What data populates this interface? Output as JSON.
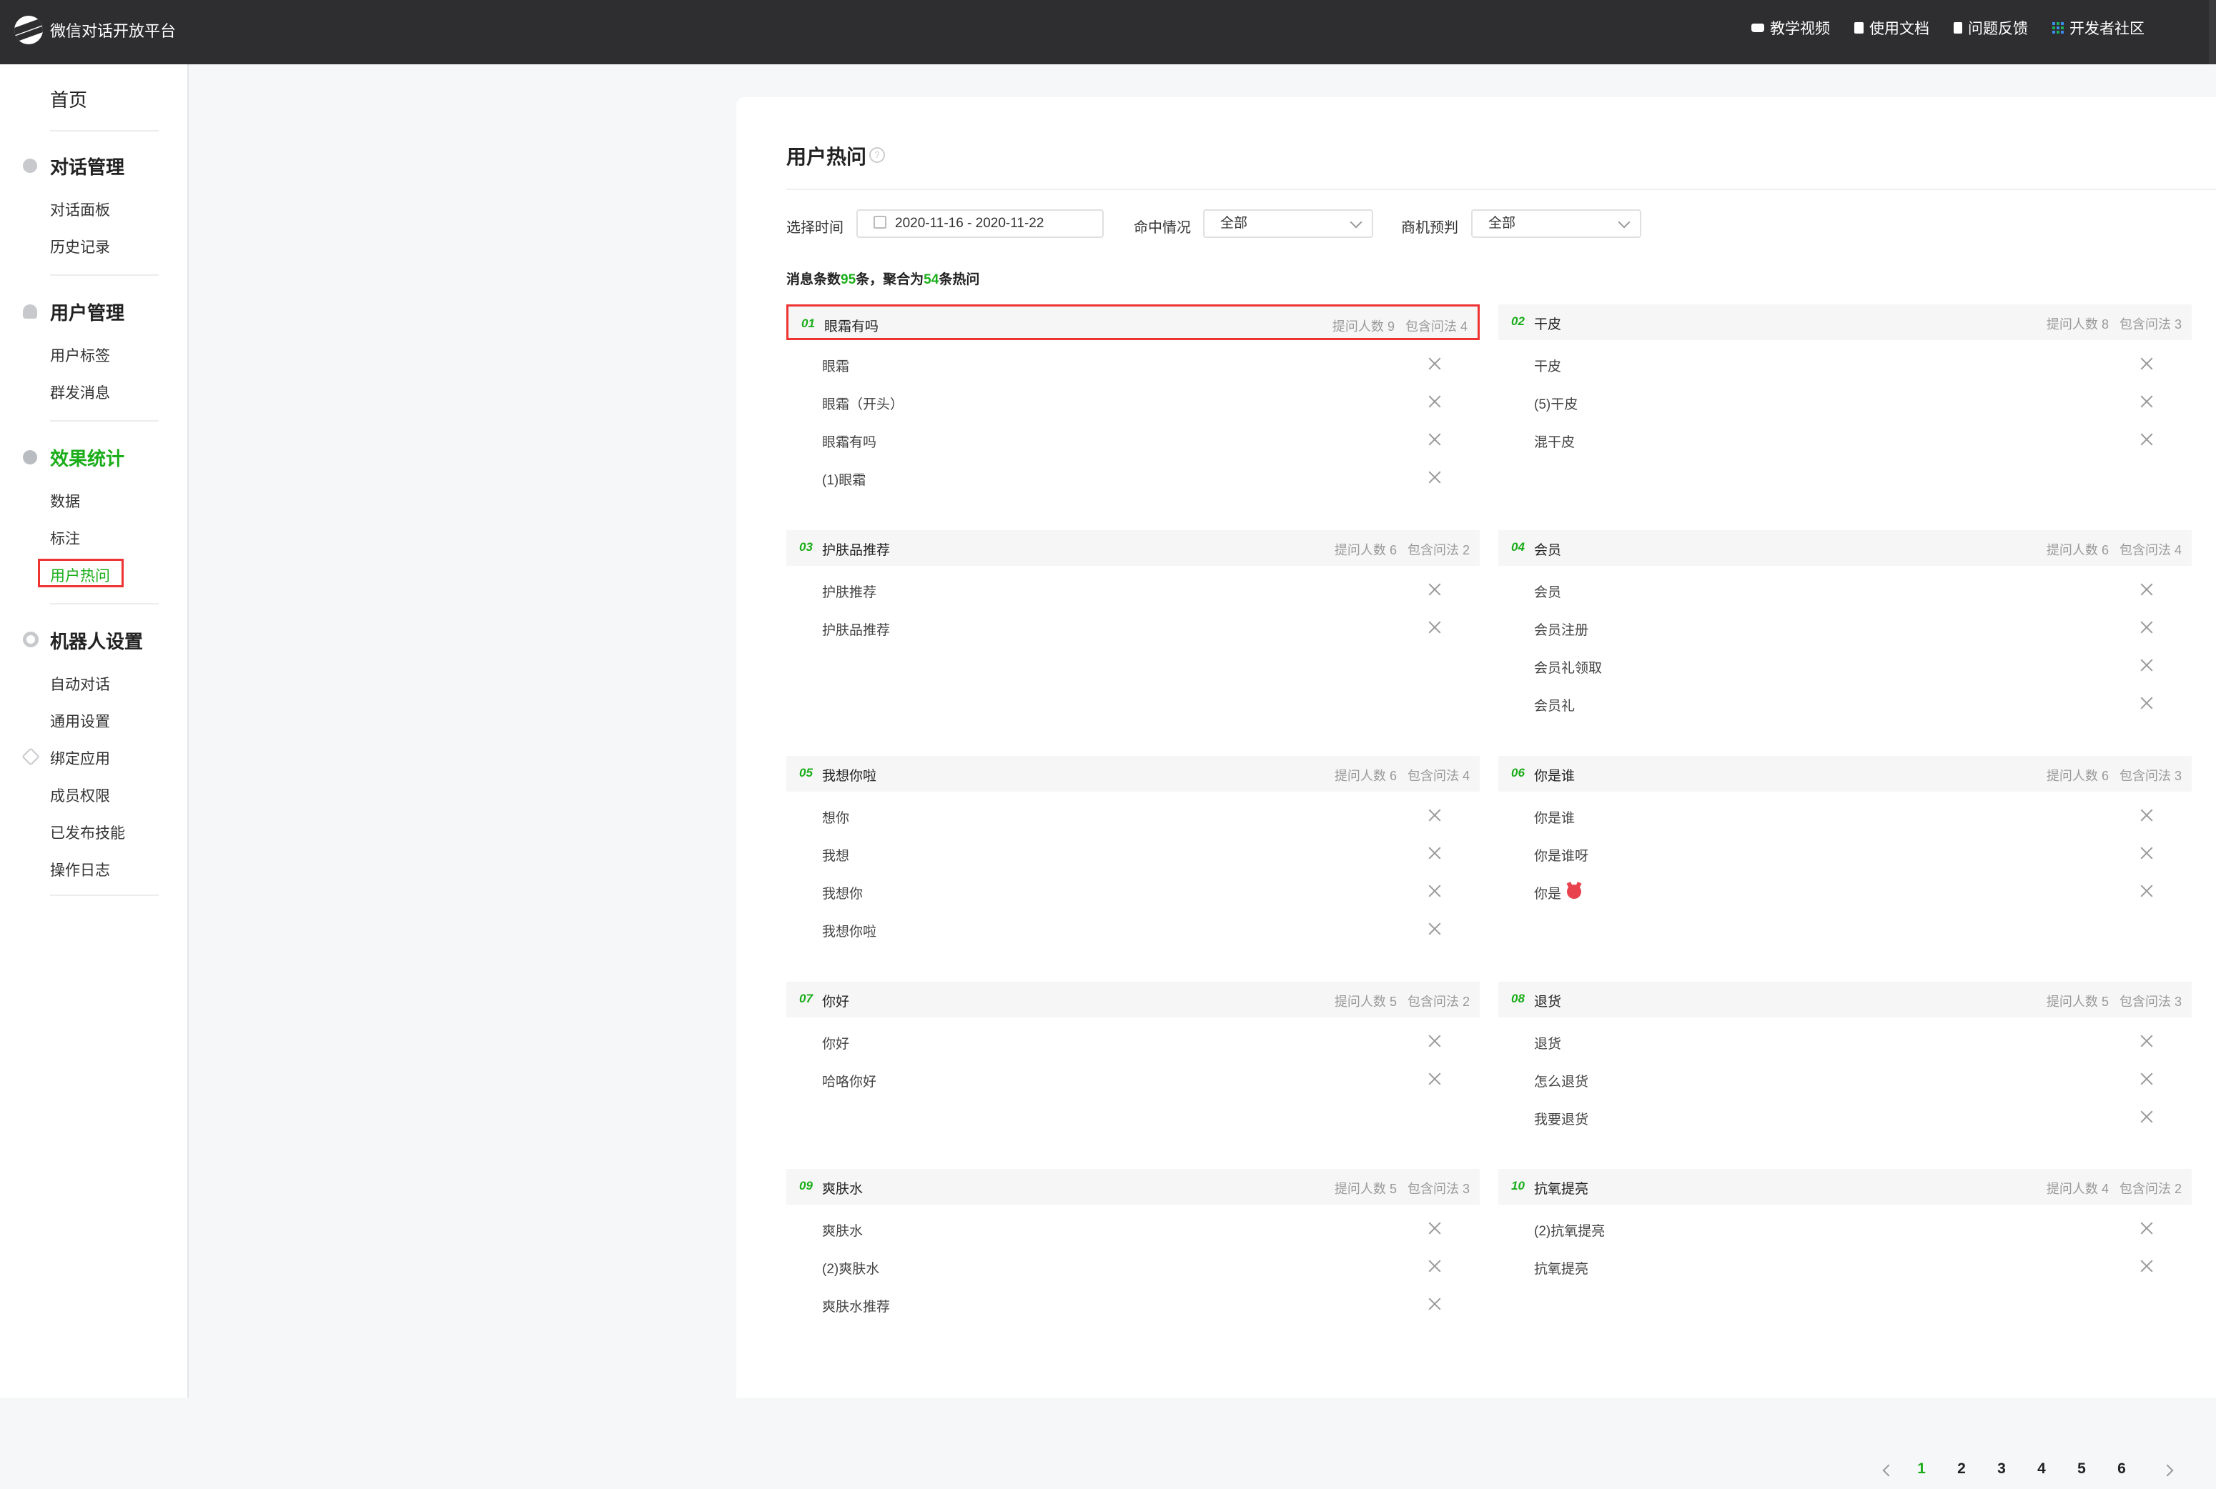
{
  "app": {
    "title": "微信对话开放平台"
  },
  "topnav": {
    "links": [
      "教学视频",
      "使用文档",
      "问题反馈",
      "开发者社区"
    ]
  },
  "sidebar": {
    "home": "首页",
    "groups": [
      {
        "title": "对话管理",
        "items": [
          "对话面板",
          "历史记录"
        ]
      },
      {
        "title": "用户管理",
        "items": [
          "用户标签",
          "群发消息"
        ]
      },
      {
        "title": "效果统计",
        "items": [
          "数据",
          "标注",
          "用户热问"
        ]
      },
      {
        "title": "机器人设置",
        "items": [
          "自动对话",
          "通用设置",
          "绑定应用",
          "成员权限",
          "已发布技能",
          "操作日志"
        ]
      }
    ]
  },
  "page": {
    "title": "用户热问",
    "filters": {
      "time_label": "选择时间",
      "time_value": "2020-11-16 - 2020-11-22",
      "hit_label": "命中情况",
      "hit_value": "全部",
      "biz_label": "商机预判",
      "biz_value": "全部"
    },
    "summary": {
      "prefix": "消息条数",
      "msg_count": "95",
      "mid": "条，聚合为",
      "hot_count": "54",
      "suffix": "条热问"
    },
    "stat_askers_label": "提问人数",
    "stat_variants_label": "包含问法",
    "clusters": [
      {
        "idx": "01",
        "name": "眼霜有吗",
        "askers": "9",
        "variants": "4",
        "questions": [
          "眼霜",
          "眼霜（开头）",
          "眼霜有吗",
          "(1)眼霜"
        ]
      },
      {
        "idx": "02",
        "name": "干皮",
        "askers": "8",
        "variants": "3",
        "questions": [
          "干皮",
          "(5)干皮",
          "混干皮"
        ]
      },
      {
        "idx": "03",
        "name": "护肤品推荐",
        "askers": "6",
        "variants": "2",
        "questions": [
          "护肤推荐",
          "护肤品推荐"
        ]
      },
      {
        "idx": "04",
        "name": "会员",
        "askers": "6",
        "variants": "4",
        "questions": [
          "会员",
          "会员注册",
          "会员礼领取",
          "会员礼"
        ]
      },
      {
        "idx": "05",
        "name": "我想你啦",
        "askers": "6",
        "variants": "4",
        "questions": [
          "想你",
          "我想",
          "我想你",
          "我想你啦"
        ]
      },
      {
        "idx": "06",
        "name": "你是谁",
        "askers": "6",
        "variants": "3",
        "questions": [
          "你是谁",
          "你是谁呀",
          "你是"
        ]
      },
      {
        "idx": "07",
        "name": "你好",
        "askers": "5",
        "variants": "2",
        "questions": [
          "你好",
          "哈咯你好"
        ]
      },
      {
        "idx": "08",
        "name": "退货",
        "askers": "5",
        "variants": "3",
        "questions": [
          "退货",
          "怎么退货",
          "我要退货"
        ]
      },
      {
        "idx": "09",
        "name": "爽肤水",
        "askers": "5",
        "variants": "3",
        "questions": [
          "爽肤水",
          "(2)爽肤水",
          "爽肤水推荐"
        ]
      },
      {
        "idx": "10",
        "name": "抗氧提亮",
        "askers": "4",
        "variants": "2",
        "questions": [
          "(2)抗氧提亮",
          "抗氧提亮"
        ]
      }
    ],
    "pagination": {
      "pages": [
        "1",
        "2",
        "3",
        "4",
        "5",
        "6"
      ],
      "current": "1"
    }
  }
}
